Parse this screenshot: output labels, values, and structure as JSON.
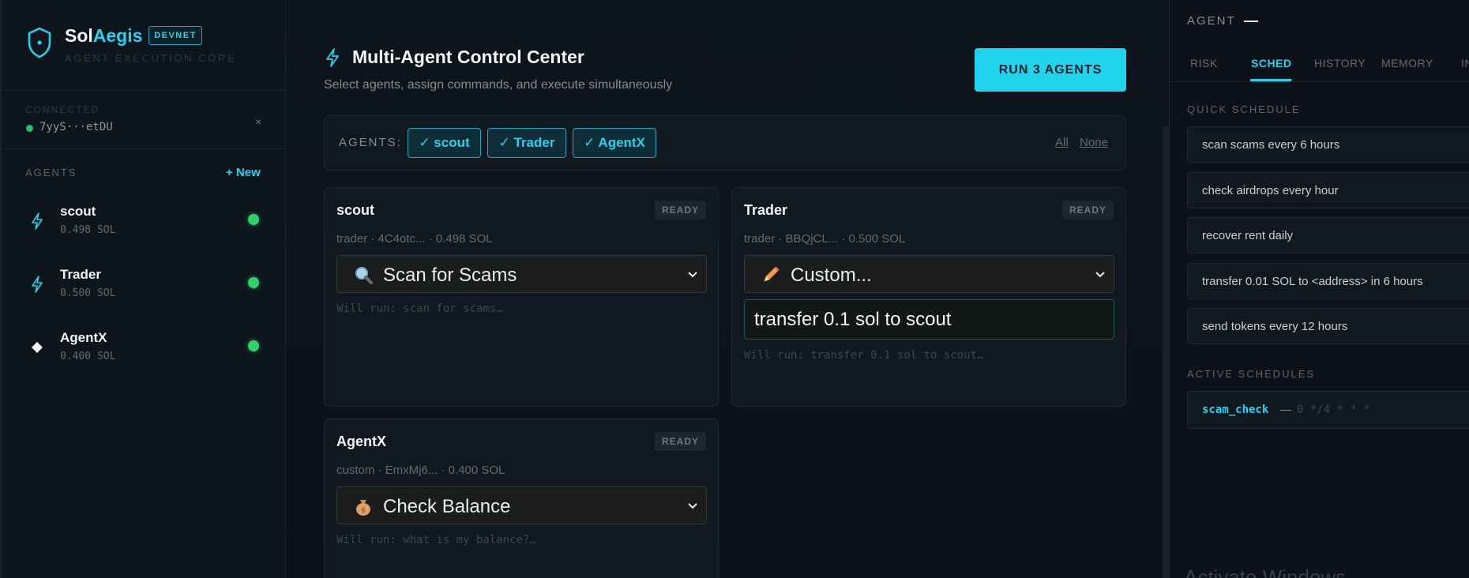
{
  "brand": {
    "name_primary": "Sol",
    "name_accent": "Aegis",
    "network_badge": "DEVNET",
    "subtitle": "AGENT EXECUTION CORE"
  },
  "wallet": {
    "label": "CONNECTED",
    "address": "7yyS···etDU",
    "close": "×"
  },
  "sidebar": {
    "agents_header": "AGENTS",
    "new_button": "+ New",
    "agents": [
      {
        "name": "scout",
        "balance": "0.498 SOL",
        "icon": "bolt-icon"
      },
      {
        "name": "Trader",
        "balance": "0.500 SOL",
        "icon": "bolt-icon"
      },
      {
        "name": "AgentX",
        "balance": "0.400 SOL",
        "icon": "diamond-icon"
      }
    ]
  },
  "main": {
    "title": "Multi-Agent Control Center",
    "subtitle": "Select agents, assign commands, and execute simultaneously",
    "run_button": "RUN 3 AGENTS",
    "selector": {
      "label": "AGENTS:",
      "chips": [
        "✓ scout",
        "✓ Trader",
        "✓ AgentX"
      ],
      "all": "All",
      "none": "None"
    },
    "cards": [
      {
        "name": "scout",
        "status": "READY",
        "meta": "trader · 4C4otc... · 0.498 SOL",
        "command": "Scan for Scams",
        "command_icon": "magnifier-icon",
        "will_run": "Will run: scan for scams…"
      },
      {
        "name": "Trader",
        "status": "READY",
        "meta": "trader · BBQjCL... · 0.500 SOL",
        "command": "Custom...",
        "command_icon": "pencil-icon",
        "custom_value": "transfer 0.1 sol to scout",
        "will_run": "Will run: transfer 0.1 sol to scout…"
      },
      {
        "name": "AgentX",
        "status": "READY",
        "meta": "custom · EmxMj6... · 0.400 SOL",
        "command": "Check Balance",
        "command_icon": "money-bag-icon",
        "will_run": "Will run: what is my balance?…"
      }
    ]
  },
  "right_panel": {
    "agent_label": "AGENT",
    "tabs": [
      "RISK",
      "SCHED",
      "HISTORY",
      "MEMORY",
      "IN"
    ],
    "active_tab": "SCHED",
    "quick_schedule_header": "QUICK SCHEDULE",
    "quick_schedule": [
      "scan scams every 6 hours",
      "check airdrops every hour",
      "recover rent daily",
      "transfer 0.01 SOL to <address> in 6 hours",
      "send tokens every 12 hours"
    ],
    "active_schedules_header": "ACTIVE SCHEDULES",
    "active_schedules": [
      {
        "name": "scam_check",
        "separator": "—",
        "cron": "0 */4 * * *"
      }
    ],
    "watermark": "Activate Windows"
  },
  "colors": {
    "accent": "#22d3ee",
    "status_online": "#2fd06e",
    "background": "#0b1016"
  }
}
